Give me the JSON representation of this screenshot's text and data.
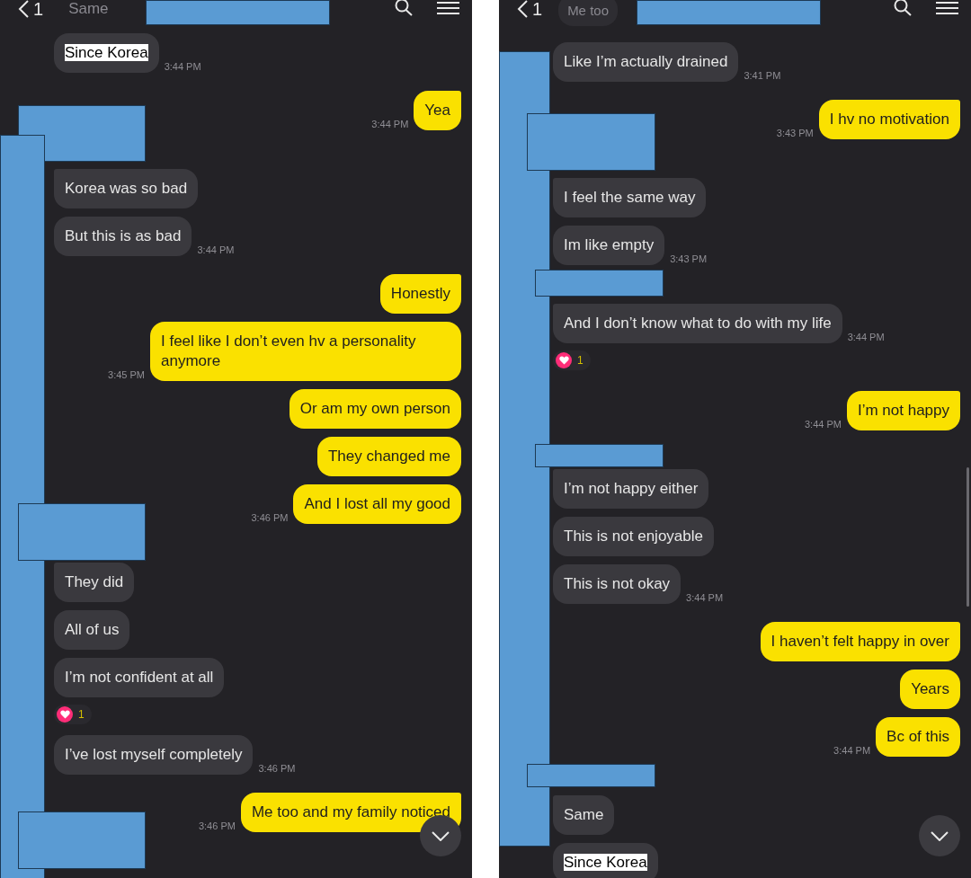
{
  "panels": [
    {
      "header": {
        "back_count": "1",
        "faded": {
          "kind": "text",
          "text": "Same"
        }
      },
      "messages": [
        {
          "kind": "incoming",
          "text": "Since Korea",
          "highlighted": true,
          "time": "3:44 PM"
        },
        {
          "kind": "outgoing",
          "text": "Yea",
          "time": "3:44 PM"
        },
        {
          "kind": "incoming",
          "text": "Korea was so bad",
          "new_group": true
        },
        {
          "kind": "incoming",
          "text": "But this is as bad",
          "time": "3:44 PM"
        },
        {
          "kind": "outgoing",
          "text": "Honestly"
        },
        {
          "kind": "outgoing",
          "text": "I feel like I don’t even hv a personality anymore",
          "time": "3:45 PM"
        },
        {
          "kind": "outgoing",
          "text": "Or am my own person"
        },
        {
          "kind": "outgoing",
          "text": "They changed me"
        },
        {
          "kind": "outgoing",
          "text": "And I lost all my good",
          "time": "3:46 PM"
        },
        {
          "kind": "incoming",
          "text": "They did",
          "new_group": true
        },
        {
          "kind": "incoming",
          "text": "All of us"
        },
        {
          "kind": "incoming",
          "text": "I’m not confident at all",
          "reaction": "1"
        },
        {
          "kind": "incoming",
          "text": "I’ve lost myself completely",
          "time": "3:46 PM"
        },
        {
          "kind": "outgoing",
          "text": "Me too and my family noticed",
          "time": "3:46 PM"
        }
      ]
    },
    {
      "header": {
        "back_count": "1",
        "faded": {
          "kind": "bubble",
          "text": "Me too"
        }
      },
      "messages": [
        {
          "kind": "incoming",
          "text": "Like I’m actually drained",
          "time": "3:41 PM"
        },
        {
          "kind": "outgoing",
          "text": "I hv no motivation",
          "time": "3:43 PM"
        },
        {
          "kind": "incoming",
          "text": "I feel the same way",
          "new_group": true
        },
        {
          "kind": "incoming",
          "text": "Im like empty",
          "time": "3:43 PM"
        },
        {
          "kind": "incoming",
          "text": "And I don’t know what to do with my life",
          "new_group": true,
          "time": "3:44 PM",
          "reaction": "1"
        },
        {
          "kind": "outgoing",
          "text": "I’m not happy",
          "time": "3:44 PM"
        },
        {
          "kind": "incoming",
          "text": "I’m not happy either",
          "new_group": true
        },
        {
          "kind": "incoming",
          "text": "This is not enjoyable"
        },
        {
          "kind": "incoming",
          "text": "This is not okay",
          "time": "3:44 PM"
        },
        {
          "kind": "outgoing",
          "text": "I haven’t felt happy in over"
        },
        {
          "kind": "outgoing",
          "text": "Years"
        },
        {
          "kind": "outgoing",
          "text": "Bc of this",
          "time": "3:44 PM"
        },
        {
          "kind": "incoming",
          "text": "Same",
          "new_group": true
        },
        {
          "kind": "incoming",
          "text": "Since Korea",
          "highlighted": true
        }
      ]
    }
  ]
}
